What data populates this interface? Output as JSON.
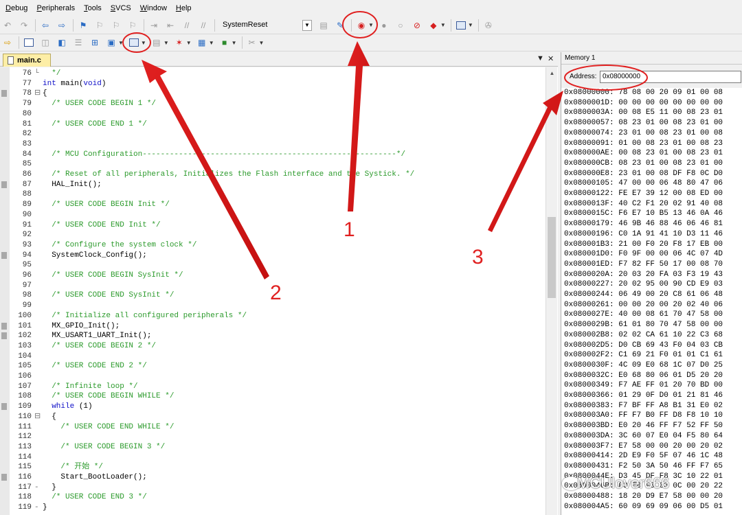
{
  "menu": [
    {
      "first": "D",
      "rest": "ebug"
    },
    {
      "first": "P",
      "rest": "eripherals"
    },
    {
      "first": "T",
      "rest": "ools"
    },
    {
      "first": "S",
      "rest": "VCS"
    },
    {
      "first": "W",
      "rest": "indow"
    },
    {
      "first": "H",
      "rest": "elp"
    }
  ],
  "toolbar": {
    "target_name": "SystemReset"
  },
  "editor": {
    "tab_label": "main.c",
    "lines": [
      {
        "n": "76",
        "fold": "└",
        "text": "  */",
        "type": "comment",
        "bp": false
      },
      {
        "n": "77",
        "fold": "",
        "text": "int main(void)",
        "type": "mixed",
        "bp": false
      },
      {
        "n": "78",
        "fold": "⊟",
        "text": "{",
        "type": "plain",
        "bp": true
      },
      {
        "n": "79",
        "fold": "",
        "text": "  /* USER CODE BEGIN 1 */",
        "type": "comment",
        "bp": false
      },
      {
        "n": "80",
        "fold": "",
        "text": "",
        "type": "plain",
        "bp": false
      },
      {
        "n": "81",
        "fold": "",
        "text": "  /* USER CODE END 1 */",
        "type": "comment",
        "bp": false
      },
      {
        "n": "82",
        "fold": "",
        "text": "",
        "type": "plain",
        "bp": false
      },
      {
        "n": "83",
        "fold": "",
        "text": "",
        "type": "plain",
        "bp": false
      },
      {
        "n": "84",
        "fold": "",
        "text": "  /* MCU Configuration--------------------------------------------------------*/",
        "type": "comment",
        "bp": false
      },
      {
        "n": "85",
        "fold": "",
        "text": "",
        "type": "plain",
        "bp": false
      },
      {
        "n": "86",
        "fold": "",
        "text": "  /* Reset of all peripherals, Initializes the Flash interface and the Systick. */",
        "type": "comment",
        "bp": false
      },
      {
        "n": "87",
        "fold": "",
        "text": "  HAL_Init();",
        "type": "plain",
        "bp": true
      },
      {
        "n": "88",
        "fold": "",
        "text": "",
        "type": "plain",
        "bp": false
      },
      {
        "n": "89",
        "fold": "",
        "text": "  /* USER CODE BEGIN Init */",
        "type": "comment",
        "bp": false
      },
      {
        "n": "90",
        "fold": "",
        "text": "",
        "type": "plain",
        "bp": false
      },
      {
        "n": "91",
        "fold": "",
        "text": "  /* USER CODE END Init */",
        "type": "comment",
        "bp": false
      },
      {
        "n": "92",
        "fold": "",
        "text": "",
        "type": "plain",
        "bp": false
      },
      {
        "n": "93",
        "fold": "",
        "text": "  /* Configure the system clock */",
        "type": "comment",
        "bp": false
      },
      {
        "n": "94",
        "fold": "",
        "text": "  SystemClock_Config();",
        "type": "plain",
        "bp": true
      },
      {
        "n": "95",
        "fold": "",
        "text": "",
        "type": "plain",
        "bp": false
      },
      {
        "n": "96",
        "fold": "",
        "text": "  /* USER CODE BEGIN SysInit */",
        "type": "comment",
        "bp": false
      },
      {
        "n": "97",
        "fold": "",
        "text": "",
        "type": "plain",
        "bp": false
      },
      {
        "n": "98",
        "fold": "",
        "text": "  /* USER CODE END SysInit */",
        "type": "comment",
        "bp": false
      },
      {
        "n": "99",
        "fold": "",
        "text": "",
        "type": "plain",
        "bp": false
      },
      {
        "n": "100",
        "fold": "",
        "text": "  /* Initialize all configured peripherals */",
        "type": "comment",
        "bp": false
      },
      {
        "n": "101",
        "fold": "",
        "text": "  MX_GPIO_Init();",
        "type": "plain",
        "bp": true
      },
      {
        "n": "102",
        "fold": "",
        "text": "  MX_USART1_UART_Init();",
        "type": "plain",
        "bp": true
      },
      {
        "n": "103",
        "fold": "",
        "text": "  /* USER CODE BEGIN 2 */",
        "type": "comment",
        "bp": false
      },
      {
        "n": "104",
        "fold": "",
        "text": "",
        "type": "plain",
        "bp": false
      },
      {
        "n": "105",
        "fold": "",
        "text": "  /* USER CODE END 2 */",
        "type": "comment",
        "bp": false
      },
      {
        "n": "106",
        "fold": "",
        "text": "",
        "type": "plain",
        "bp": false
      },
      {
        "n": "107",
        "fold": "",
        "text": "  /* Infinite loop */",
        "type": "comment",
        "bp": false
      },
      {
        "n": "108",
        "fold": "",
        "text": "  /* USER CODE BEGIN WHILE */",
        "type": "comment",
        "bp": false
      },
      {
        "n": "109",
        "fold": "",
        "text": "  while (1)",
        "type": "mixed",
        "bp": true
      },
      {
        "n": "110",
        "fold": "⊟",
        "text": "  {",
        "type": "plain",
        "bp": false
      },
      {
        "n": "111",
        "fold": "",
        "text": "    /* USER CODE END WHILE */",
        "type": "comment",
        "bp": false
      },
      {
        "n": "112",
        "fold": "",
        "text": "",
        "type": "plain",
        "bp": false
      },
      {
        "n": "113",
        "fold": "",
        "text": "    /* USER CODE BEGIN 3 */",
        "type": "comment",
        "bp": false
      },
      {
        "n": "114",
        "fold": "",
        "text": "",
        "type": "plain",
        "bp": false
      },
      {
        "n": "115",
        "fold": "",
        "text": "    /* 开始 */",
        "type": "comment",
        "bp": false
      },
      {
        "n": "116",
        "fold": "",
        "text": "    Start_BootLoader();",
        "type": "plain",
        "bp": true
      },
      {
        "n": "117",
        "fold": "-",
        "text": "  }",
        "type": "plain",
        "bp": false
      },
      {
        "n": "118",
        "fold": "",
        "text": "  /* USER CODE END 3 */",
        "type": "comment",
        "bp": false
      },
      {
        "n": "119",
        "fold": "-",
        "text": "}",
        "type": "plain",
        "bp": false
      }
    ]
  },
  "memory": {
    "title": "Memory 1",
    "address_label": "Address:",
    "address_value": "0x08000000",
    "rows": [
      "0x08000000: 78 08 00 20 09 01 00 08",
      "0x0800001D: 00 00 00 00 00 00 00 00",
      "0x0800003A: 00 08 E5 11 00 08 23 01",
      "0x08000057: 08 23 01 00 08 23 01 00",
      "0x08000074: 23 01 00 08 23 01 00 08",
      "0x08000091: 01 00 08 23 01 00 08 23",
      "0x080000AE: 00 08 23 01 00 08 23 01",
      "0x080000CB: 08 23 01 00 08 23 01 00",
      "0x080000E8: 23 01 00 08 DF F8 0C D0",
      "0x08000105: 47 00 00 06 48 80 47 06",
      "0x08000122: FE E7 39 12 00 08 ED 00",
      "0x0800013F: 40 C2 F1 20 02 91 40 08",
      "0x0800015C: F6 E7 10 B5 13 46 0A 46",
      "0x08000179: 46 9B 46 88 46 06 46 81",
      "0x08000196: C0 1A 91 41 10 D3 11 46",
      "0x080001B3: 21 00 F0 20 F8 17 EB 00",
      "0x080001D0: F0 9F 00 00 06 4C 07 4D",
      "0x080001ED: F7 82 FF 50 17 00 08 70",
      "0x0800020A: 20 03 20 FA 03 F3 19 43",
      "0x08000227: 20 02 95 00 90 CD E9 03",
      "0x08000244: 06 49 00 20 C8 61 06 48",
      "0x08000261: 00 00 20 00 20 02 40 06",
      "0x0800027E: 40 00 08 61 70 47 58 00",
      "0x0800029B: 61 01 80 70 47 58 00 00",
      "0x080002B8: 02 02 CA 61 10 22 C3 68",
      "0x080002D5: D0 CB 69 43 F0 04 03 CB",
      "0x080002F2: C1 69 21 F0 01 01 C1 61",
      "0x0800030F: 4C 09 E0 68 1C 07 D0 25",
      "0x0800032C: E0 68 80 06 01 D5 20 20",
      "0x08000349: F7 AE FF 01 20 70 BD 00",
      "0x08000366: 01 29 0F D0 01 21 81 46",
      "0x08000383: F7 BF FF A8 B1 31 E0 02",
      "0x080003A0: FF F7 B0 FF D8 F8 10 10",
      "0x080003BD: E0 20 46 FF F7 52 FF 50",
      "0x080003DA: 3C 60 07 E0 04 F5 80 64",
      "0x080003F7: E7 58 00 00 20 00 20 02",
      "0x08000414: 2D E9 F0 5F 07 46 1C 48",
      "0x08000431: F2 50 3A 50 46 FF F7 65",
      "0x0800044E: D3 45 DF F8 3C 10 22 01",
      "0x0800046B: 03 E0 F0 03 0C 00 20 22",
      "0x08000488: 18 20 D9 E7 58 00 00 20",
      "0x080004A5: 60 09 69 09 06 00 D5 01"
    ]
  },
  "annotations": {
    "labels": [
      "1",
      "2",
      "3"
    ],
    "color": "#e02020"
  },
  "watermark": "MCUlover666",
  "colors": {
    "comment": "#2b9a2b",
    "keyword": "#1010c8",
    "tab_active": "#fdeea6"
  }
}
